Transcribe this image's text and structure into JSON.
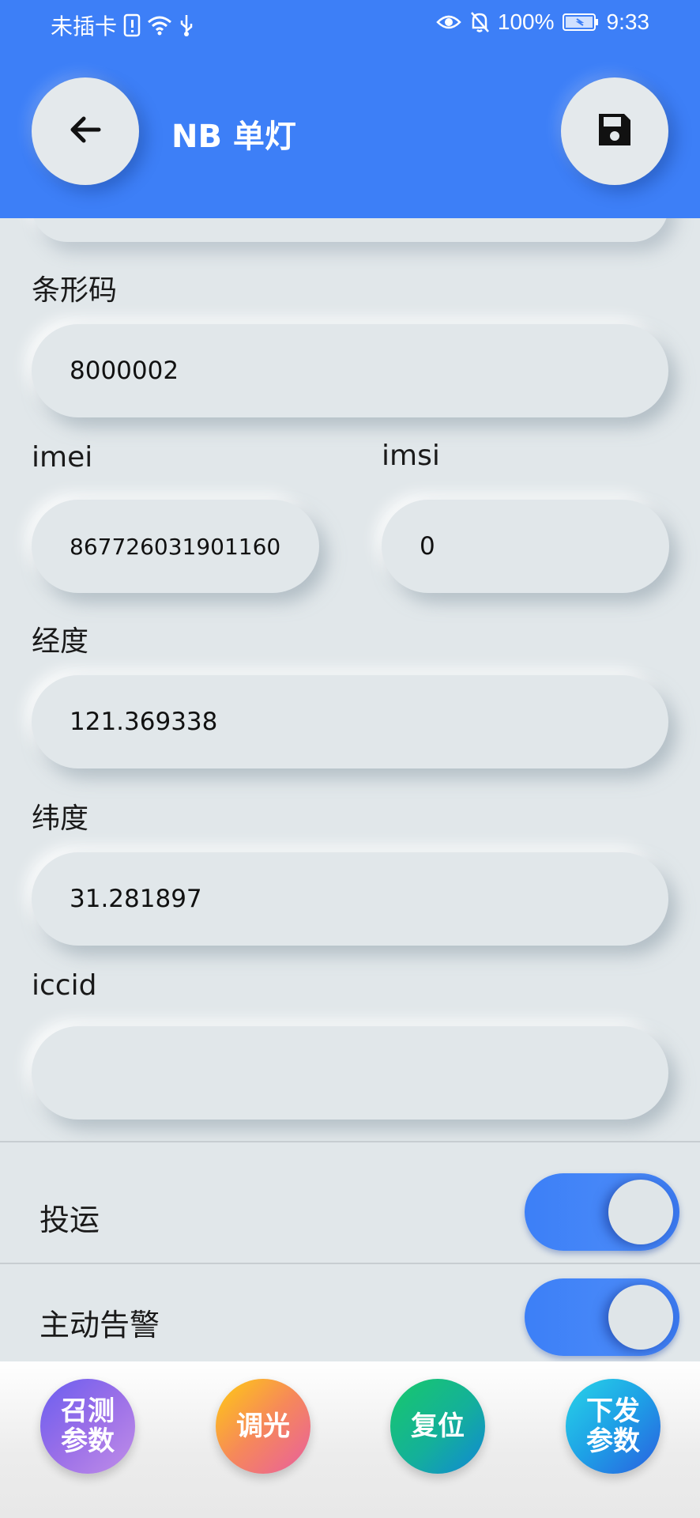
{
  "status_bar": {
    "sim_text": "未插卡",
    "battery_percent": "100%",
    "time": "9:33"
  },
  "header": {
    "title": "NB 单灯",
    "back_icon": "arrow-left-icon",
    "save_icon": "floppy-disk-icon"
  },
  "form": {
    "barcode_label": "条形码",
    "barcode_value": "8000002",
    "imei_label": "imei",
    "imei_value": "867726031901160",
    "imsi_label": "imsi",
    "imsi_value": "0",
    "longitude_label": "经度",
    "longitude_value": "121.369338",
    "latitude_label": "纬度",
    "latitude_value": "31.281897",
    "iccid_label": "iccid",
    "iccid_value": ""
  },
  "switches": [
    {
      "label": "投运",
      "on": true
    },
    {
      "label": "主动告警",
      "on": true
    }
  ],
  "actions": {
    "query_params_line1": "召测",
    "query_params_line2": "参数",
    "dimming": "调光",
    "reset": "复位",
    "send_params_line1": "下发",
    "send_params_line2": "参数"
  },
  "colors": {
    "primary": "#3d7ff7",
    "background": "#e1e7ea"
  }
}
